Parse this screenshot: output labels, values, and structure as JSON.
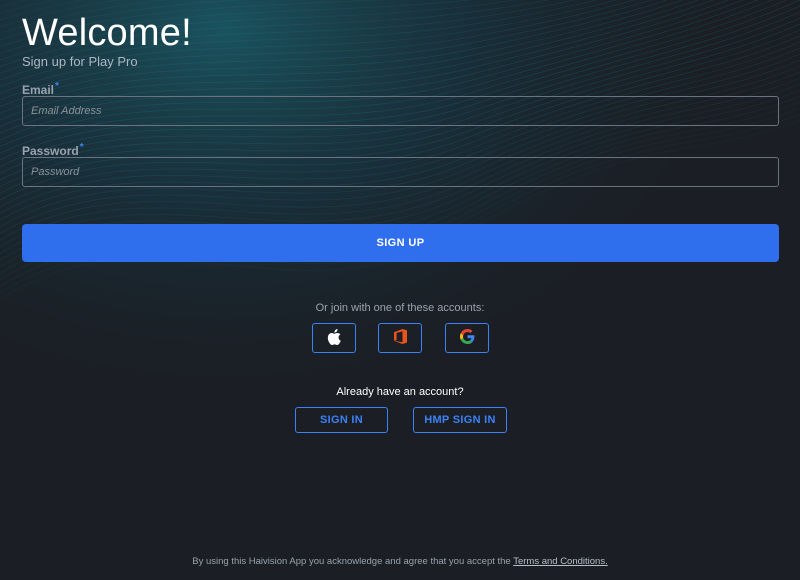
{
  "header": {
    "title": "Welcome!",
    "subtitle": "Sign up for Play Pro"
  },
  "form": {
    "email": {
      "label": "Email",
      "required_mark": "*",
      "placeholder": "Email Address",
      "value": ""
    },
    "password": {
      "label": "Password",
      "required_mark": "*",
      "placeholder": "Password",
      "value": ""
    },
    "signup_label": "SIGN UP"
  },
  "social": {
    "prompt": "Or join with one of these accounts:",
    "providers": [
      {
        "name": "apple-icon"
      },
      {
        "name": "office-icon"
      },
      {
        "name": "google-icon"
      }
    ]
  },
  "account": {
    "prompt": "Already have an account?",
    "signin_label": "SIGN IN",
    "hmp_signin_label": "HMP SIGN IN"
  },
  "footer": {
    "text": "By using this Haivision App you acknowledge and agree that you accept the",
    "link_label": "Terms and Conditions."
  },
  "colors": {
    "background": "#1b1e24",
    "accent": "#2f6fed",
    "outline_blue": "#3b82f6",
    "wave_teal": "#1aa6b7"
  }
}
